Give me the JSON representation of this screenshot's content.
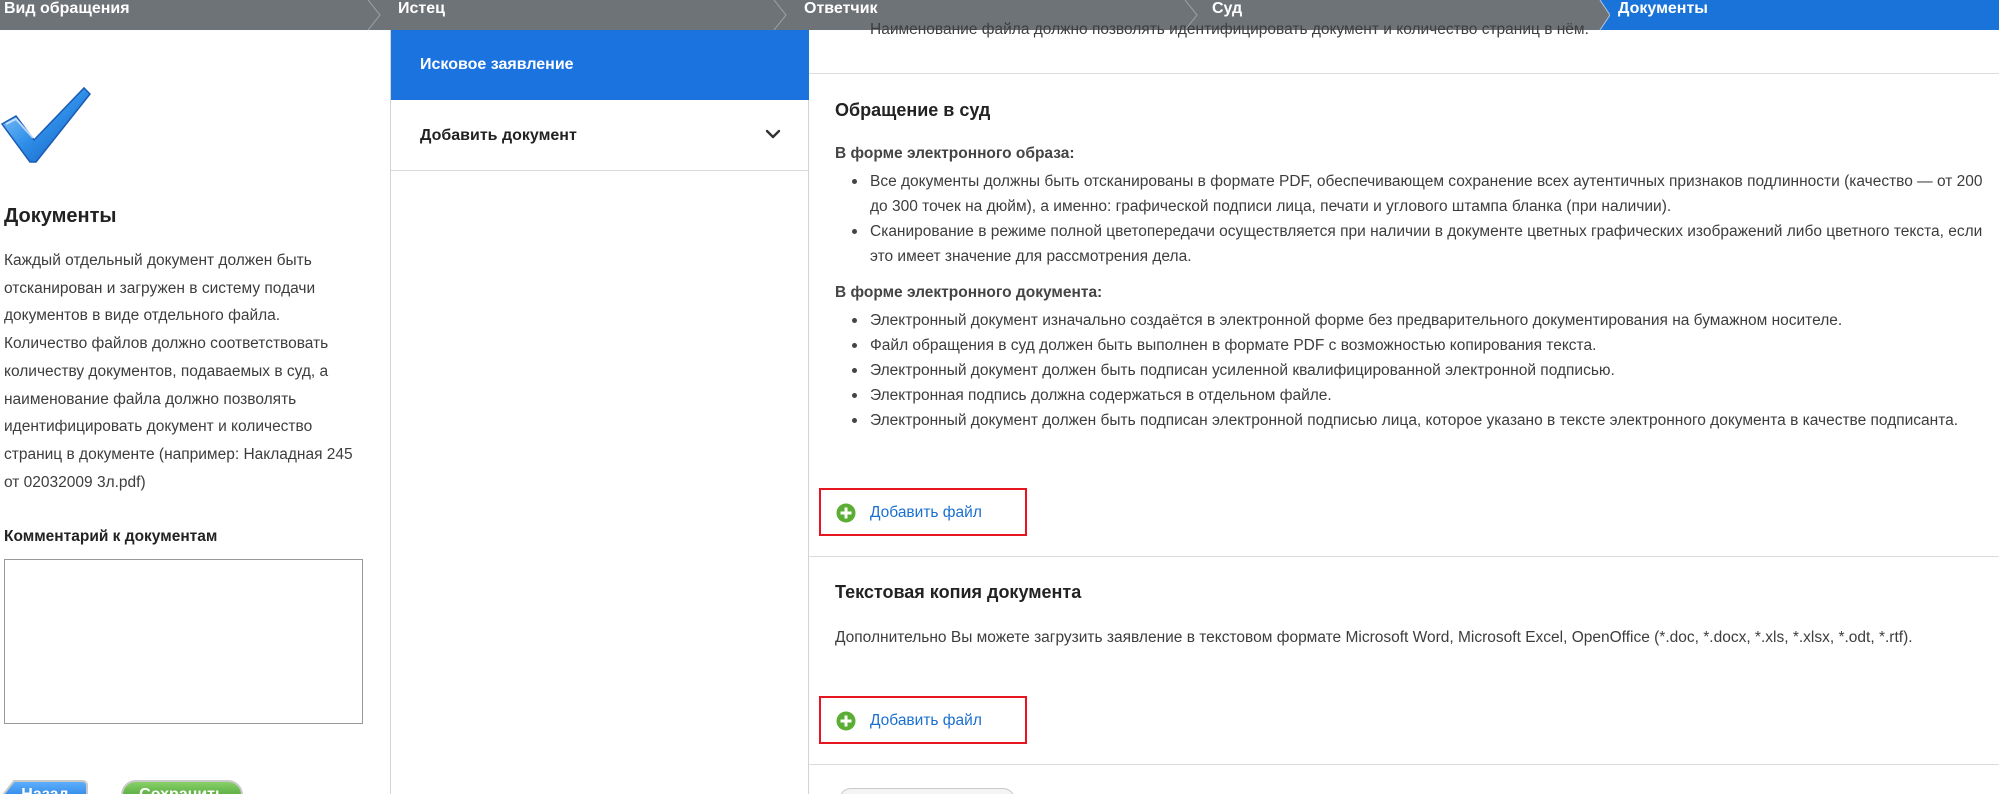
{
  "steps": [
    "Вид обращения",
    "Истец",
    "Ответчик",
    "Суд",
    "Документы"
  ],
  "left": {
    "title": "Документы",
    "description": "Каждый отдельный документ должен быть отсканирован и загружен в систему подачи документов в виде отдельного файла. Количество файлов должно соответствовать количеству документов, подаваемых в суд, а наименование файла должно позволять идентифицировать документ и количество страниц в документе (например: Накладная 245 от 02032009 3л.pdf)",
    "comment_label": "Комментарий к документам",
    "comment_value": "",
    "back_label": "Назад",
    "save_label": "Сохранить"
  },
  "middle": {
    "active_item": "Исковое заявление",
    "add_item": "Добавить документ"
  },
  "right": {
    "cut_text": "Наименование файла должно позволять идентифицировать документ и количество страниц в нём.",
    "appeal": {
      "title": "Обращение в суд",
      "image_form_title": "В форме электронного образа:",
      "image_form_items": [
        "Все документы должны быть отсканированы в формате PDF, обеспечивающем сохранение всех аутентичных признаков подлинности (качество — от 200 до 300 точек на дюйм), а именно: графической подписи лица, печати и углового штампа бланка (при наличии).",
        "Сканирование в режиме полной цветопередачи осуществляется при наличии в документе цветных графических изображений либо цветного текста, если это имеет значение для рассмотрения дела."
      ],
      "doc_form_title": "В форме электронного документа:",
      "doc_form_items": [
        "Электронный документ изначально создаётся в электронной форме без предварительного документирования на бумажном носителе.",
        "Файл обращения в суд должен быть выполнен в формате PDF с возможностью копирования текста.",
        "Электронный документ должен быть подписан усиленной квалифицированной электронной подписью.",
        "Электронная подпись должна содержаться в отдельном файле.",
        "Электронный документ должен быть подписан электронной подписью лица, которое указано в тексте электронного документа в качестве подписанта."
      ],
      "add_file_label": "Добавить файл"
    },
    "text_copy": {
      "title": "Текстовая копия документа",
      "description": "Дополнительно Вы можете загрузить заявление в текстовом формате Microsoft Word, Microsoft Excel, OpenOffice (*.doc, *.docx, *.xls, *.xlsx, *.odt, *.rtf).",
      "add_file_label": "Добавить файл"
    }
  },
  "colors": {
    "step_bar": "#6e7378",
    "active_step": "#1a73d9",
    "active_item": "#1b73e0",
    "highlight_border": "#e8141f",
    "link": "#1a6fd1",
    "plus_icon": "#5aae33",
    "back_button": "#1f7fe0",
    "save_button": "#4aa52a"
  }
}
